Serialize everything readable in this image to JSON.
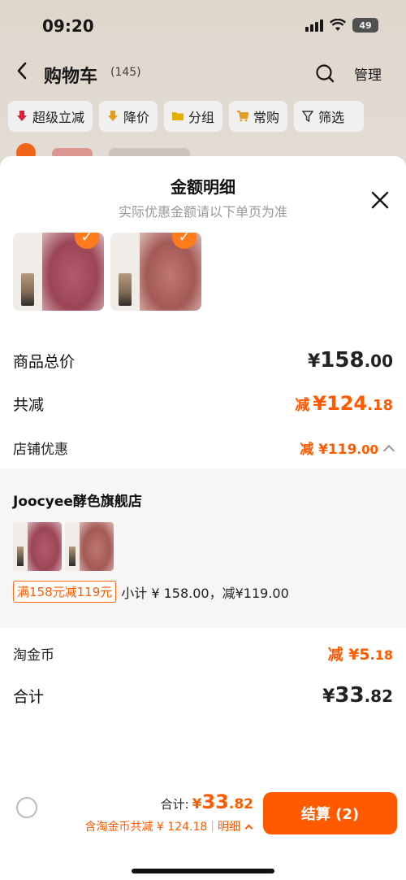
{
  "status_bar": {
    "time": "09:20",
    "battery": "49"
  },
  "nav": {
    "back_icon": "chevron-left-icon",
    "title": "购物车",
    "count": "(145)",
    "manage_label": "管理"
  },
  "filters": [
    {
      "label": "超级立减",
      "icon": "arrow-down-icon",
      "color": "#e8243c"
    },
    {
      "label": "降价",
      "icon": "arrow-down-icon",
      "color": "#f5a623"
    },
    {
      "label": "分组",
      "icon": "folder-icon",
      "color": "#f5b900"
    },
    {
      "label": "常购",
      "icon": "cart-icon",
      "color": "#f5a623"
    },
    {
      "label": "筛选",
      "icon": "filter-icon",
      "color": "#333333"
    }
  ],
  "sheet": {
    "title": "金额明细",
    "subtitle": "实际优惠金额请以下单页为准",
    "rows": {
      "total_label": "商品总价",
      "total_cur": "¥",
      "total_int": "158",
      "total_dec": ".00",
      "reduce_label": "共减",
      "reduce_pre": "减",
      "reduce_cur": "¥",
      "reduce_int": "124",
      "reduce_dec": ".18",
      "shop_discount_label": "店铺优惠",
      "shop_discount_value": "减 ¥119",
      "shop_discount_dec": ".00"
    },
    "shop": {
      "name": "Joocyee酵色旗舰店",
      "promo_tag": "满158元减119元",
      "subtotal": "小计 ¥ 158.00，减¥119.00"
    },
    "coin": {
      "label": "淘金币",
      "value": "减 ¥5",
      "dec": ".18"
    },
    "sum": {
      "label": "合计",
      "cur": "¥",
      "int": "33",
      "dec": ".82"
    }
  },
  "bottom": {
    "total_label": "合计:",
    "total_cur": "¥",
    "total_int": "33",
    "total_dec": ".82",
    "sub_text": "含淘金币共减 ¥ 124.18",
    "detail_label": "明细",
    "checkout_label": "结算 (2)"
  },
  "colors": {
    "accent": "#ff5a00",
    "check": "#ff7a1a"
  }
}
